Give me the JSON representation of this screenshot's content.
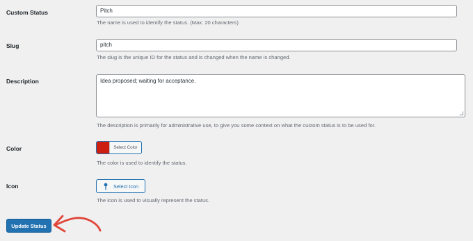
{
  "fields": {
    "name": {
      "label": "Custom Status",
      "value": "Pitch",
      "help": "The name is used to identify the status. (Max: 20 characters)"
    },
    "slug": {
      "label": "Slug",
      "value": "pitch",
      "help": "The slug is the unique ID for the status and is changed when the name is changed."
    },
    "description": {
      "label": "Description",
      "value": "Idea proposed; waiting for acceptance.",
      "help": "The description is primarily for administrative use, to give you some context on what the custom status is to be used for."
    },
    "color": {
      "label": "Color",
      "button_label": "Select Color",
      "swatch": "#cc1f12",
      "help": "The color is used to identify the status."
    },
    "icon": {
      "label": "Icon",
      "button_label": "Select Icon",
      "icon_name": "pin-icon",
      "help": "The icon is used to visually represent the status."
    }
  },
  "submit": {
    "label": "Update Status"
  },
  "colors": {
    "accent": "#2271b1",
    "annotation_arrow": "#e0473a"
  }
}
